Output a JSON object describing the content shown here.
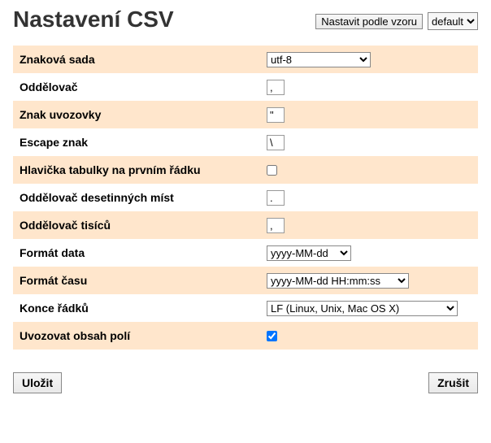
{
  "header": {
    "title": "Nastavení CSV",
    "template_button": "Nastavit podle vzoru",
    "profile_select": {
      "value": "default",
      "options": [
        "default"
      ]
    }
  },
  "rows": [
    {
      "label": "Znaková sada",
      "type": "select",
      "value": "utf-8",
      "options": [
        "utf-8"
      ],
      "width": "w120"
    },
    {
      "label": "Oddělovač",
      "type": "text",
      "value": ","
    },
    {
      "label": "Znak uvozovky",
      "type": "text",
      "value": "\""
    },
    {
      "label": "Escape znak",
      "type": "text",
      "value": "\\"
    },
    {
      "label": "Hlavička tabulky na prvním řádku",
      "type": "checkbox",
      "checked": false
    },
    {
      "label": "Oddělovač desetinných míst",
      "type": "text",
      "value": "."
    },
    {
      "label": "Oddělovač tisíců",
      "type": "text",
      "value": ","
    },
    {
      "label": "Formát data",
      "type": "select",
      "value": "yyyy-MM-dd",
      "options": [
        "yyyy-MM-dd"
      ],
      "width": "w110"
    },
    {
      "label": "Formát času",
      "type": "select",
      "value": "yyyy-MM-dd HH:mm:ss",
      "options": [
        "yyyy-MM-dd HH:mm:ss"
      ],
      "width": "w175"
    },
    {
      "label": "Konce řádků",
      "type": "select",
      "value": "LF (Linux, Unix, Mac OS X)",
      "options": [
        "LF (Linux, Unix, Mac OS X)"
      ],
      "width": "w235"
    },
    {
      "label": "Uvozovat obsah polí",
      "type": "checkbox",
      "checked": true
    }
  ],
  "footer": {
    "save": "Uložit",
    "cancel": "Zrušit"
  }
}
